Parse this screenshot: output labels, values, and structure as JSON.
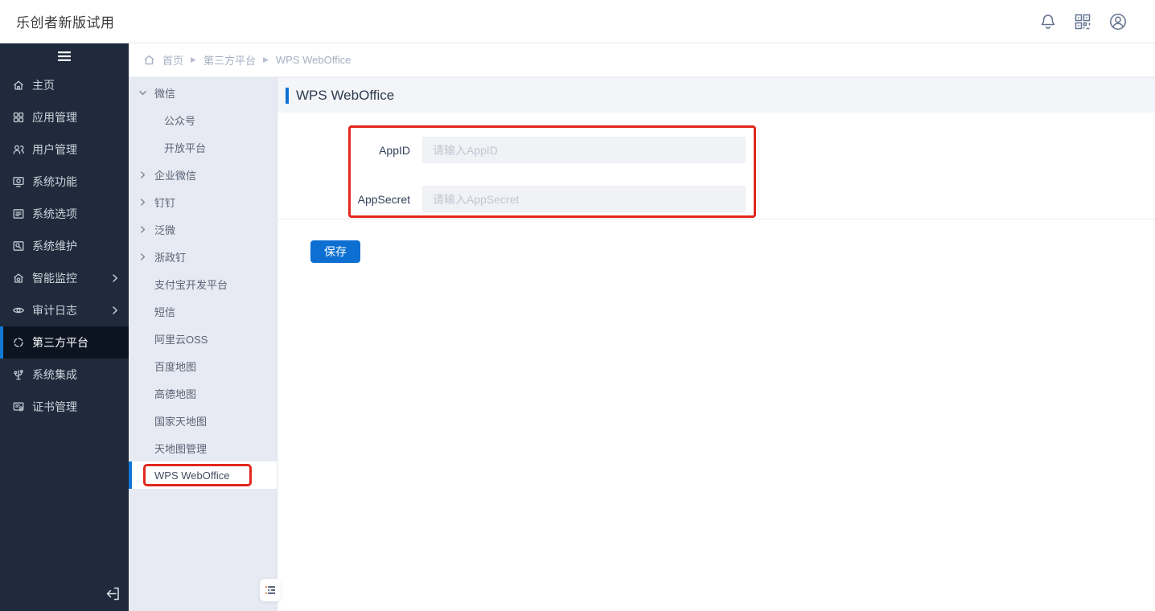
{
  "topbar": {
    "title": "乐创者新版试用"
  },
  "sidebar": {
    "items": [
      {
        "label": "主页"
      },
      {
        "label": "应用管理"
      },
      {
        "label": "用户管理"
      },
      {
        "label": "系统功能"
      },
      {
        "label": "系统选项"
      },
      {
        "label": "系统维护"
      },
      {
        "label": "智能监控",
        "expandable": true
      },
      {
        "label": "审计日志",
        "expandable": true
      },
      {
        "label": "第三方平台",
        "active": true
      },
      {
        "label": "系统集成"
      },
      {
        "label": "证书管理"
      }
    ]
  },
  "submenu": {
    "items": [
      {
        "label": "微信",
        "state": "expanded"
      },
      {
        "label": "公众号",
        "child": true
      },
      {
        "label": "开放平台",
        "child": true
      },
      {
        "label": "企业微信",
        "state": "collapsed"
      },
      {
        "label": "钉钉",
        "state": "collapsed"
      },
      {
        "label": "泛微",
        "state": "collapsed"
      },
      {
        "label": "浙政钉",
        "state": "collapsed"
      },
      {
        "label": "支付宝开发平台"
      },
      {
        "label": "短信"
      },
      {
        "label": "阿里云OSS"
      },
      {
        "label": "百度地图"
      },
      {
        "label": "高德地图"
      },
      {
        "label": "国家天地图"
      },
      {
        "label": "天地图管理"
      },
      {
        "label": "WPS WebOffice",
        "selected": true
      }
    ]
  },
  "breadcrumb": {
    "separator": "▶",
    "items": [
      "首页",
      "第三方平台",
      "WPS WebOffice"
    ]
  },
  "page": {
    "title": "WPS WebOffice"
  },
  "form": {
    "fields": [
      {
        "label": "AppID",
        "placeholder": "请输入AppID",
        "value": ""
      },
      {
        "label": "AppSecret",
        "placeholder": "请输入AppSecret",
        "value": ""
      }
    ],
    "save_label": "保存"
  },
  "colors": {
    "accent": "#0e6fd2",
    "annotation": "#e2271c",
    "sidebar_bg": "#1f2b3c",
    "sidebar_active_bg": "#0c1422",
    "submenu_bg": "#e7eaf2",
    "page_header_bg": "#f4f5f9"
  }
}
